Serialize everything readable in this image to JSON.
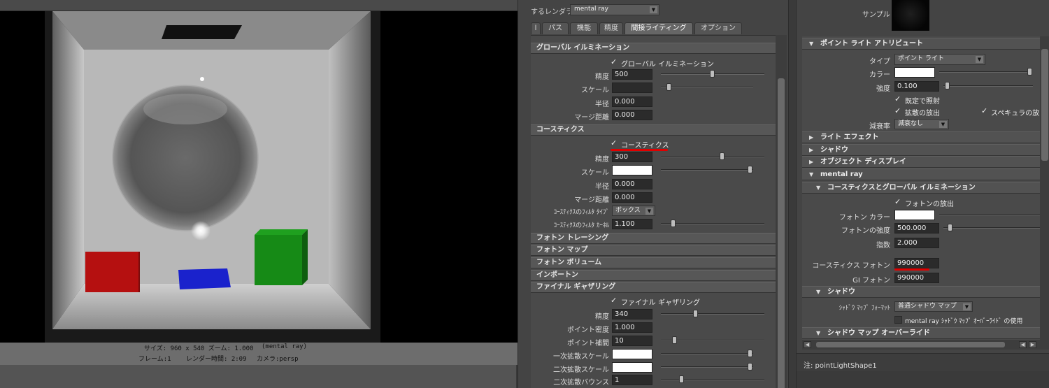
{
  "render_view": {
    "status_line1": {
      "size": "サイズ: 960 x 540 ズーム: 1.000",
      "renderer": "(mental ray)"
    },
    "status_line2": {
      "frame": "フレーム:1",
      "time": "レンダー時間: 2:09",
      "camera": "カメラ:persp"
    }
  },
  "render_settings": {
    "renderer_label": "するレンダラ",
    "renderer_value": "mental ray",
    "tabs": [
      {
        "label": "l"
      },
      {
        "label": "パス"
      },
      {
        "label": "機能"
      },
      {
        "label": "精度"
      },
      {
        "label": "間接ライティング"
      },
      {
        "label": "オプション"
      }
    ],
    "active_tab": "間接ライティング",
    "gi": {
      "header": "グローバル イルミネーション",
      "checkbox": "グローバル イルミネーション",
      "accuracy_label": "精度",
      "accuracy": "500",
      "scale_label": "スケール",
      "radius_label": "半径",
      "radius": "0.000",
      "merge_label": "マージ距離",
      "merge": "0.000"
    },
    "caustics": {
      "header": "コースティクス",
      "checkbox": "コースティクス",
      "accuracy_label": "精度",
      "accuracy": "300",
      "scale_label": "スケール",
      "radius_label": "半径",
      "radius": "0.000",
      "merge_label": "マージ距離",
      "merge": "0.000",
      "filter_type_label": "ｺｰｽﾃｨｸｽのﾌｨﾙﾀ ﾀｲﾌﾟ",
      "filter_type": "ボックス",
      "filter_kernel_label": "ｺｰｽﾃｨｸｽのﾌｨﾙﾀ ｶｰﾈﾙ",
      "filter_kernel": "1.100"
    },
    "collapsed_sections": [
      "フォトン トレーシング",
      "フォトン マップ",
      "フォトン ボリューム",
      "インポートン"
    ],
    "fg": {
      "header": "ファイナル ギャザリング",
      "checkbox": "ファイナル ギャザリング",
      "accuracy_label": "精度",
      "accuracy": "340",
      "point_density_label": "ポイント密度",
      "point_density": "1.000",
      "point_interp_label": "ポイント補間",
      "point_interp": "10",
      "primary_scale_label": "一次拡散スケール",
      "secondary_scale_label": "二次拡散スケール",
      "secondary_bounce_label": "二次拡散バウンス",
      "secondary_bounce": "1"
    }
  },
  "attr_editor": {
    "sample_label": "サンプル",
    "point_light_header": "ポイント ライト アトリビュート",
    "type_label": "タイプ",
    "type_value": "ポイント ライト",
    "color_label": "カラー",
    "intensity_label": "強度",
    "intensity": "0.100",
    "illum_default": "既定で照射",
    "emit_diffuse": "拡散の放出",
    "emit_specular": "スペキュラの放",
    "decay_label": "減衰率",
    "decay_value": "減衰なし",
    "sections": [
      "ライト エフェクト",
      "シャドウ",
      "オブジェクト ディスプレイ"
    ],
    "mental_ray_header": "mental ray",
    "caustics_gi_header": "コースティクスとグローバル イルミネーション",
    "emit_photons": "フォトンの放出",
    "photon_color_label": "フォトン カラー",
    "photon_intensity_label": "フォトンの強度",
    "photon_intensity": "500.000",
    "exponent_label": "指数",
    "exponent": "2.000",
    "caustic_photons_label": "コースティクス フォトン",
    "caustic_photons": "990000",
    "gi_photons_label": "GI フォトン",
    "gi_photons": "990000",
    "shadow_header": "シャドウ",
    "shadow_map_format_label": "ｼｬﾄﾞｳ ﾏｯﾌﾟ ﾌｫｰﾏｯﾄ",
    "shadow_map_format": "普通シャドウ マップ",
    "mr_shadow_override": "mental ray ｼｬﾄﾞｳ ﾏｯﾌﾟ ｵｰﾊﾞｰﾗｲﾄﾞ の使用",
    "shadow_map_override_header": "シャドウ マップ オーバーライド",
    "node_label": "注: pointLightShape1"
  }
}
